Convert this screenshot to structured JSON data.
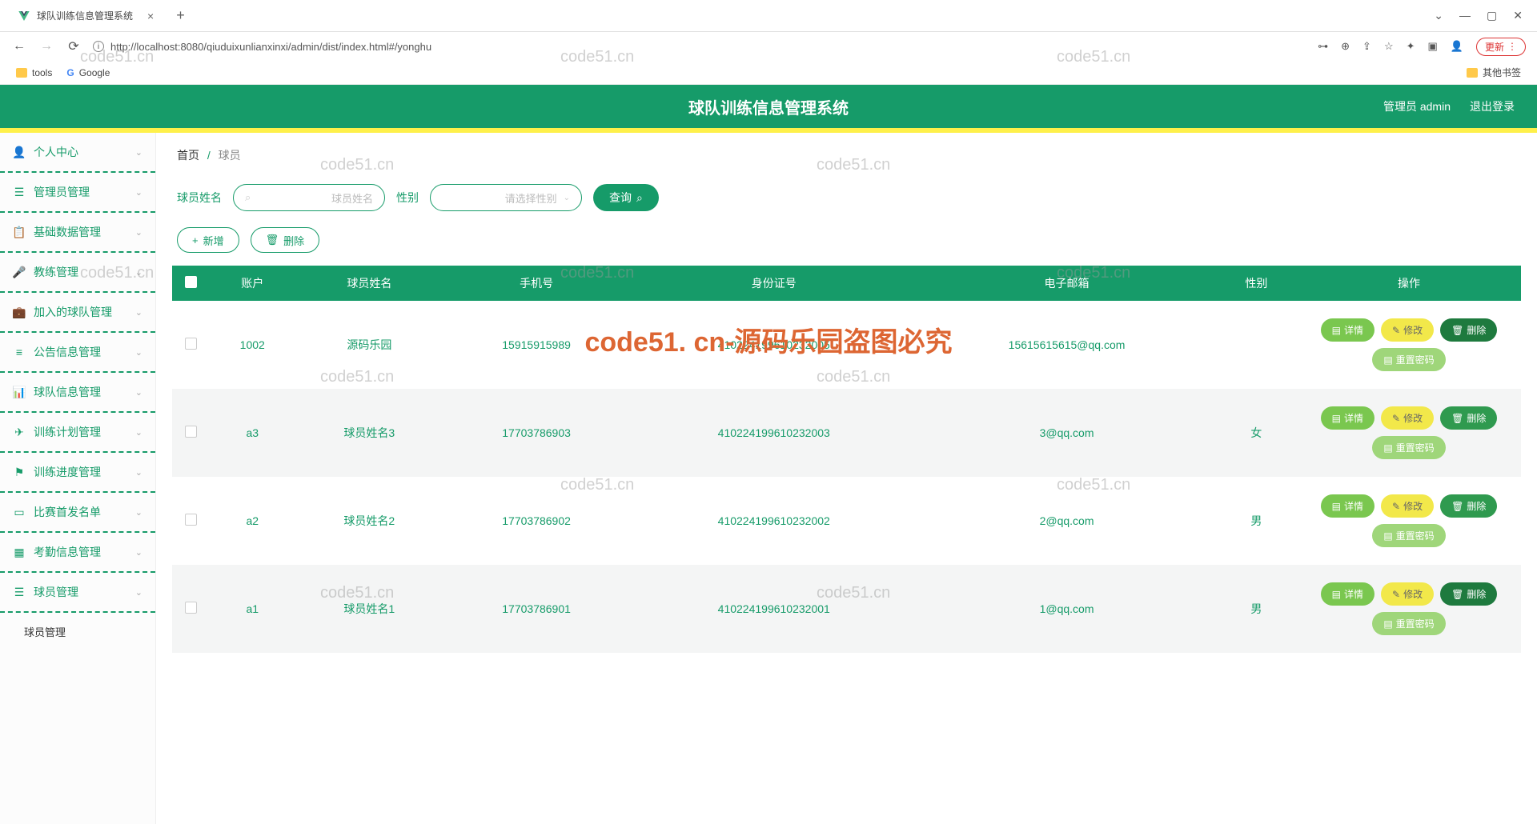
{
  "browser": {
    "tab_title": "球队训练信息管理系统",
    "url": "http://localhost:8080/qiuduixunlianxinxi/admin/dist/index.html#/yonghu",
    "update_label": "更新",
    "bookmarks": {
      "tools": "tools",
      "google": "Google",
      "other": "其他书签"
    }
  },
  "header": {
    "title": "球队训练信息管理系统",
    "user_label": "管理员 admin",
    "logout": "退出登录"
  },
  "sidebar": {
    "items": [
      {
        "label": "个人中心"
      },
      {
        "label": "管理员管理"
      },
      {
        "label": "基础数据管理"
      },
      {
        "label": "教练管理"
      },
      {
        "label": "加入的球队管理"
      },
      {
        "label": "公告信息管理"
      },
      {
        "label": "球队信息管理"
      },
      {
        "label": "训练计划管理"
      },
      {
        "label": "训练进度管理"
      },
      {
        "label": "比赛首发名单"
      },
      {
        "label": "考勤信息管理"
      },
      {
        "label": "球员管理"
      }
    ],
    "sub_item": "球员管理"
  },
  "crumb": {
    "home": "首页",
    "current": "球员"
  },
  "filter": {
    "name_label": "球员姓名",
    "name_placeholder": "球员姓名",
    "gender_label": "性别",
    "gender_placeholder": "请选择性别",
    "search": "查询"
  },
  "actions": {
    "add": "新增",
    "delete": "删除"
  },
  "table": {
    "headers": [
      "",
      "账户",
      "球员姓名",
      "手机号",
      "身份证号",
      "电子邮箱",
      "性别",
      "操作"
    ],
    "ops": {
      "detail": "详情",
      "edit": "修改",
      "delete": "删除",
      "reset": "重置密码"
    },
    "rows": [
      {
        "account": "1002",
        "name": "源码乐园",
        "phone": "15915915989",
        "idcard": "410224199610232005",
        "email": "15615615615@qq.com",
        "gender": ""
      },
      {
        "account": "a3",
        "name": "球员姓名3",
        "phone": "17703786903",
        "idcard": "410224199610232003",
        "email": "3@qq.com",
        "gender": "女"
      },
      {
        "account": "a2",
        "name": "球员姓名2",
        "phone": "17703786902",
        "idcard": "410224199610232002",
        "email": "2@qq.com",
        "gender": "男"
      },
      {
        "account": "a1",
        "name": "球员姓名1",
        "phone": "17703786901",
        "idcard": "410224199610232001",
        "email": "1@qq.com",
        "gender": "男"
      }
    ]
  },
  "watermark": {
    "text": "code51.cn",
    "red": "code51. cn-源码乐园盗图必究"
  }
}
